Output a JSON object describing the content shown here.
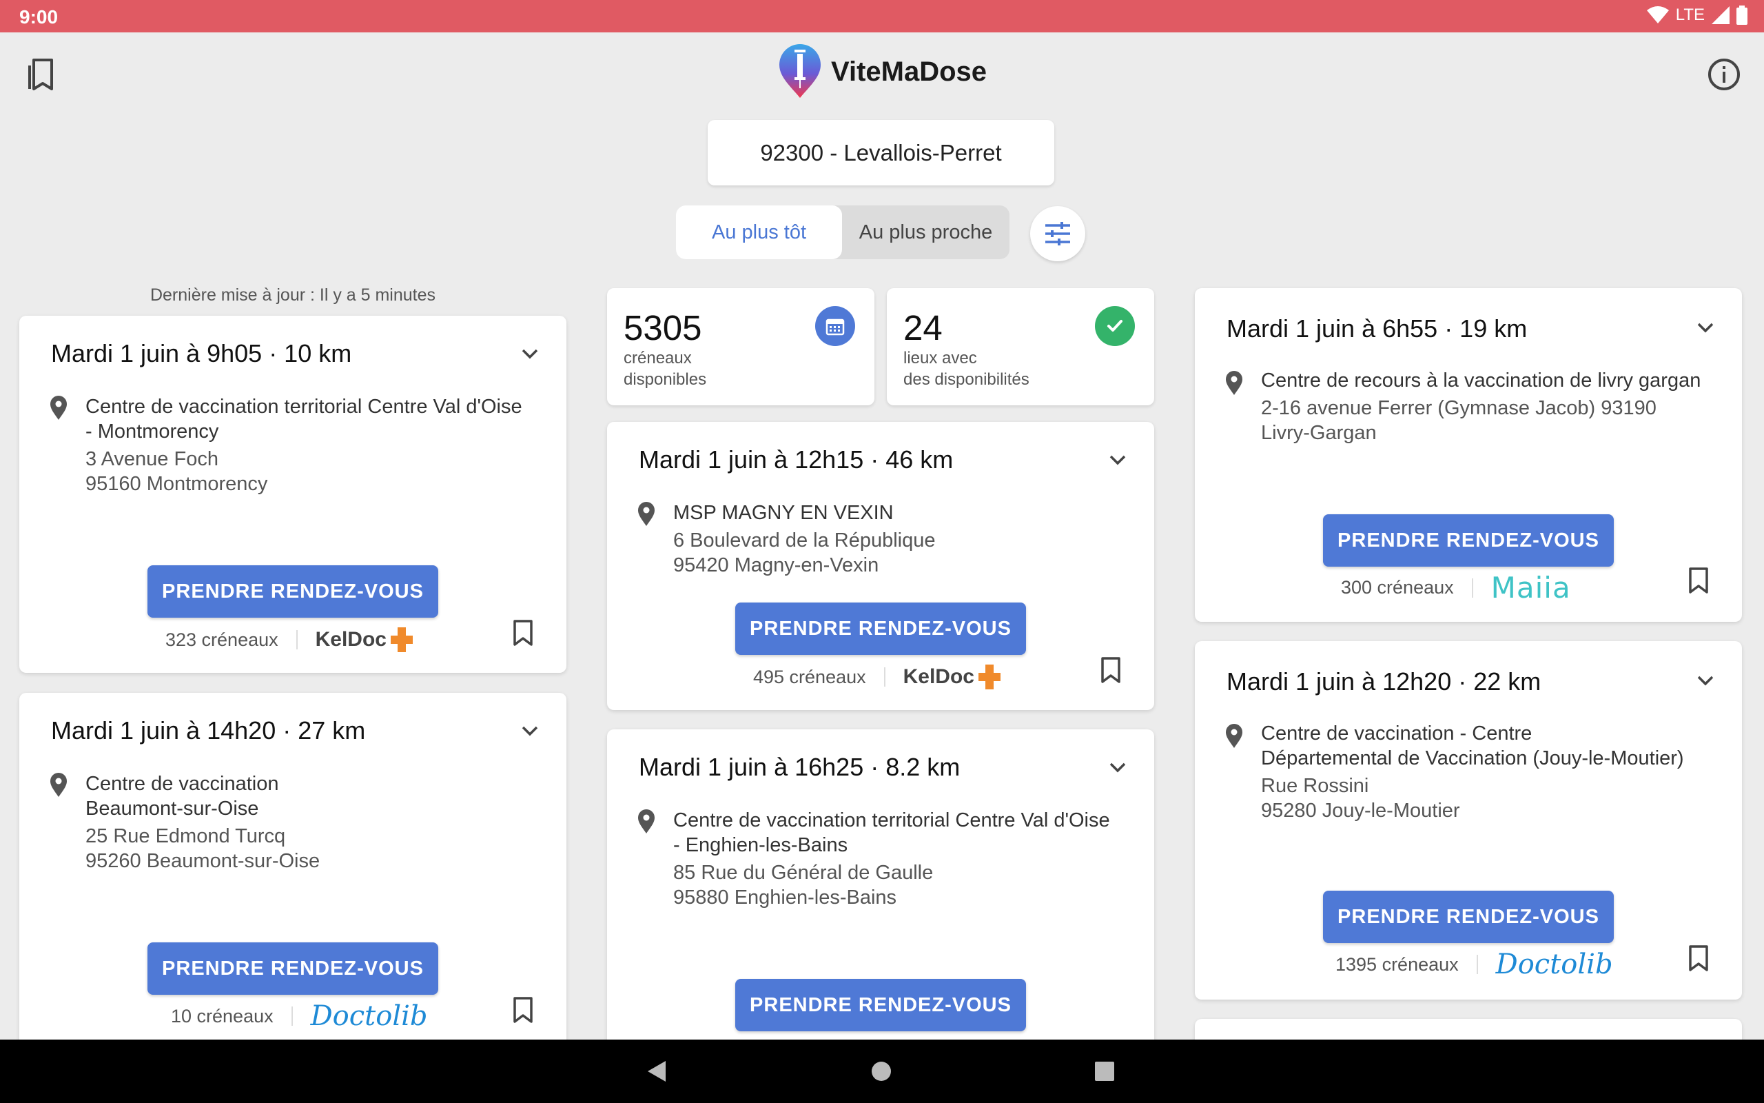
{
  "status": {
    "time": "9:00",
    "network": "LTE"
  },
  "header": {
    "app_name": "ViteMaDose"
  },
  "search": {
    "value": "92300 - Levallois-Perret"
  },
  "sort": {
    "earliest": "Au plus tôt",
    "nearest": "Au plus proche"
  },
  "last_update": "Dernière mise à jour : Il y a 5 minutes",
  "stats": {
    "slots": {
      "value": "5305",
      "label_line1": "créneaux",
      "label_line2": "disponibles"
    },
    "places": {
      "value": "24",
      "label_line1": "lieux avec",
      "label_line2": "des disponibilités"
    }
  },
  "cta_label": "PRENDRE RENDEZ-VOUS",
  "cards": [
    {
      "title": "Mardi 1 juin à 9h05 · 10 km",
      "name_line1": "Centre de vaccination territorial Centre Val d'Oise",
      "name_line2": "- Montmorency",
      "street": "3 Avenue Foch",
      "city": "95160 Montmorency",
      "slots": "323 créneaux",
      "platform": "KelDoc"
    },
    {
      "title": "Mardi 1 juin à 14h20 · 27 km",
      "name_line1": "Centre de vaccination",
      "name_line2": "Beaumont-sur-Oise",
      "street": "25 Rue Edmond Turcq",
      "city": "95260 Beaumont-sur-Oise",
      "slots": "10 créneaux",
      "platform": "Doctolib"
    },
    {
      "title": "Mardi 1 juin à 12h15 · 46 km",
      "name_line1": "MSP MAGNY EN VEXIN",
      "street": "6 Boulevard de la République",
      "city": "95420 Magny-en-Vexin",
      "slots": "495 créneaux",
      "platform": "KelDoc"
    },
    {
      "title": "Mardi 1 juin à 16h25 · 8.2 km",
      "name_line1": "Centre de vaccination territorial Centre Val d'Oise",
      "name_line2": "- Enghien-les-Bains",
      "street": "85 Rue du Général de Gaulle",
      "city": "95880 Enghien-les-Bains"
    },
    {
      "title": "Mardi 1 juin à 6h55 · 19 km",
      "name_line1": "Centre de recours à la vaccination de livry gargan",
      "street": "2-16 avenue Ferrer (Gymnase Jacob) 93190",
      "city": "Livry-Gargan",
      "slots": "300 créneaux",
      "platform": "Maiia"
    },
    {
      "title": "Mardi 1 juin à 12h20 · 22 km",
      "name_line1": "Centre de vaccination - Centre",
      "name_line2": "Départemental de Vaccination (Jouy-le-Moutier)",
      "street": "Rue Rossini",
      "city": "95280 Jouy-le-Moutier",
      "slots": "1395 créneaux",
      "platform": "Doctolib"
    }
  ],
  "colors": {
    "accent": "#4f79d6",
    "status_bar": "#e05a63",
    "success": "#34b36a",
    "keldoc_orange": "#f08a2b",
    "maiia": "#3fc3c6",
    "doctolib": "#1e8ad6"
  }
}
